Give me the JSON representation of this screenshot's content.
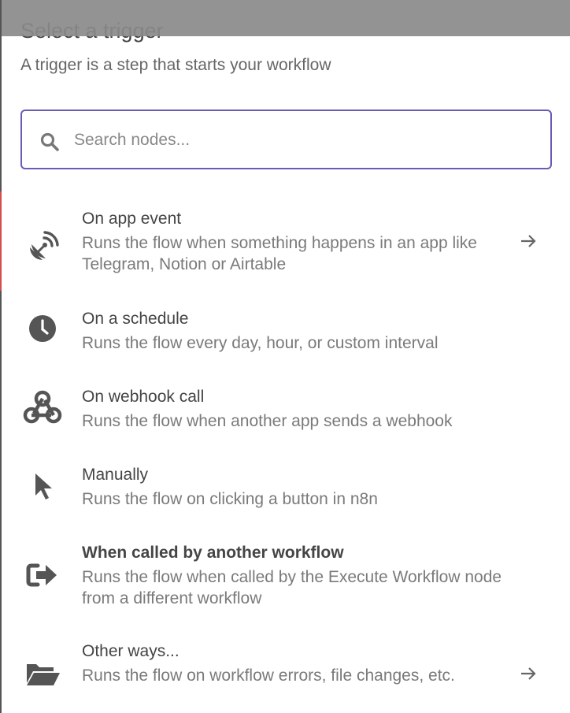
{
  "header": {
    "title": "Select a trigger",
    "subtitle": "A trigger is a step that starts your workflow"
  },
  "search": {
    "placeholder": "Search nodes...",
    "value": ""
  },
  "triggers": [
    {
      "title": "On app event",
      "description": "Runs the flow when something happens in an app like Telegram, Notion or Airtable",
      "icon": "satellite-dish-icon",
      "has_arrow": true
    },
    {
      "title": "On a schedule",
      "description": "Runs the flow every day, hour, or custom interval",
      "icon": "clock-icon",
      "has_arrow": false
    },
    {
      "title": "On webhook call",
      "description": "Runs the flow when another app sends a webhook",
      "icon": "webhook-icon",
      "has_arrow": false
    },
    {
      "title": "Manually",
      "description": "Runs the flow on clicking a button in n8n",
      "icon": "cursor-icon",
      "has_arrow": false
    },
    {
      "title": "When called by another workflow",
      "description": "Runs the flow when called by the Execute Workflow node from a different workflow",
      "icon": "sign-in-icon",
      "has_arrow": false
    },
    {
      "title": "Other ways...",
      "description": "Runs the flow on workflow errors, file changes, etc.",
      "icon": "folder-open-icon",
      "has_arrow": true
    }
  ],
  "colors": {
    "accent": "#6b5bb5",
    "text": "#444444",
    "muted": "#7a7a7a",
    "icon": "#555555"
  }
}
